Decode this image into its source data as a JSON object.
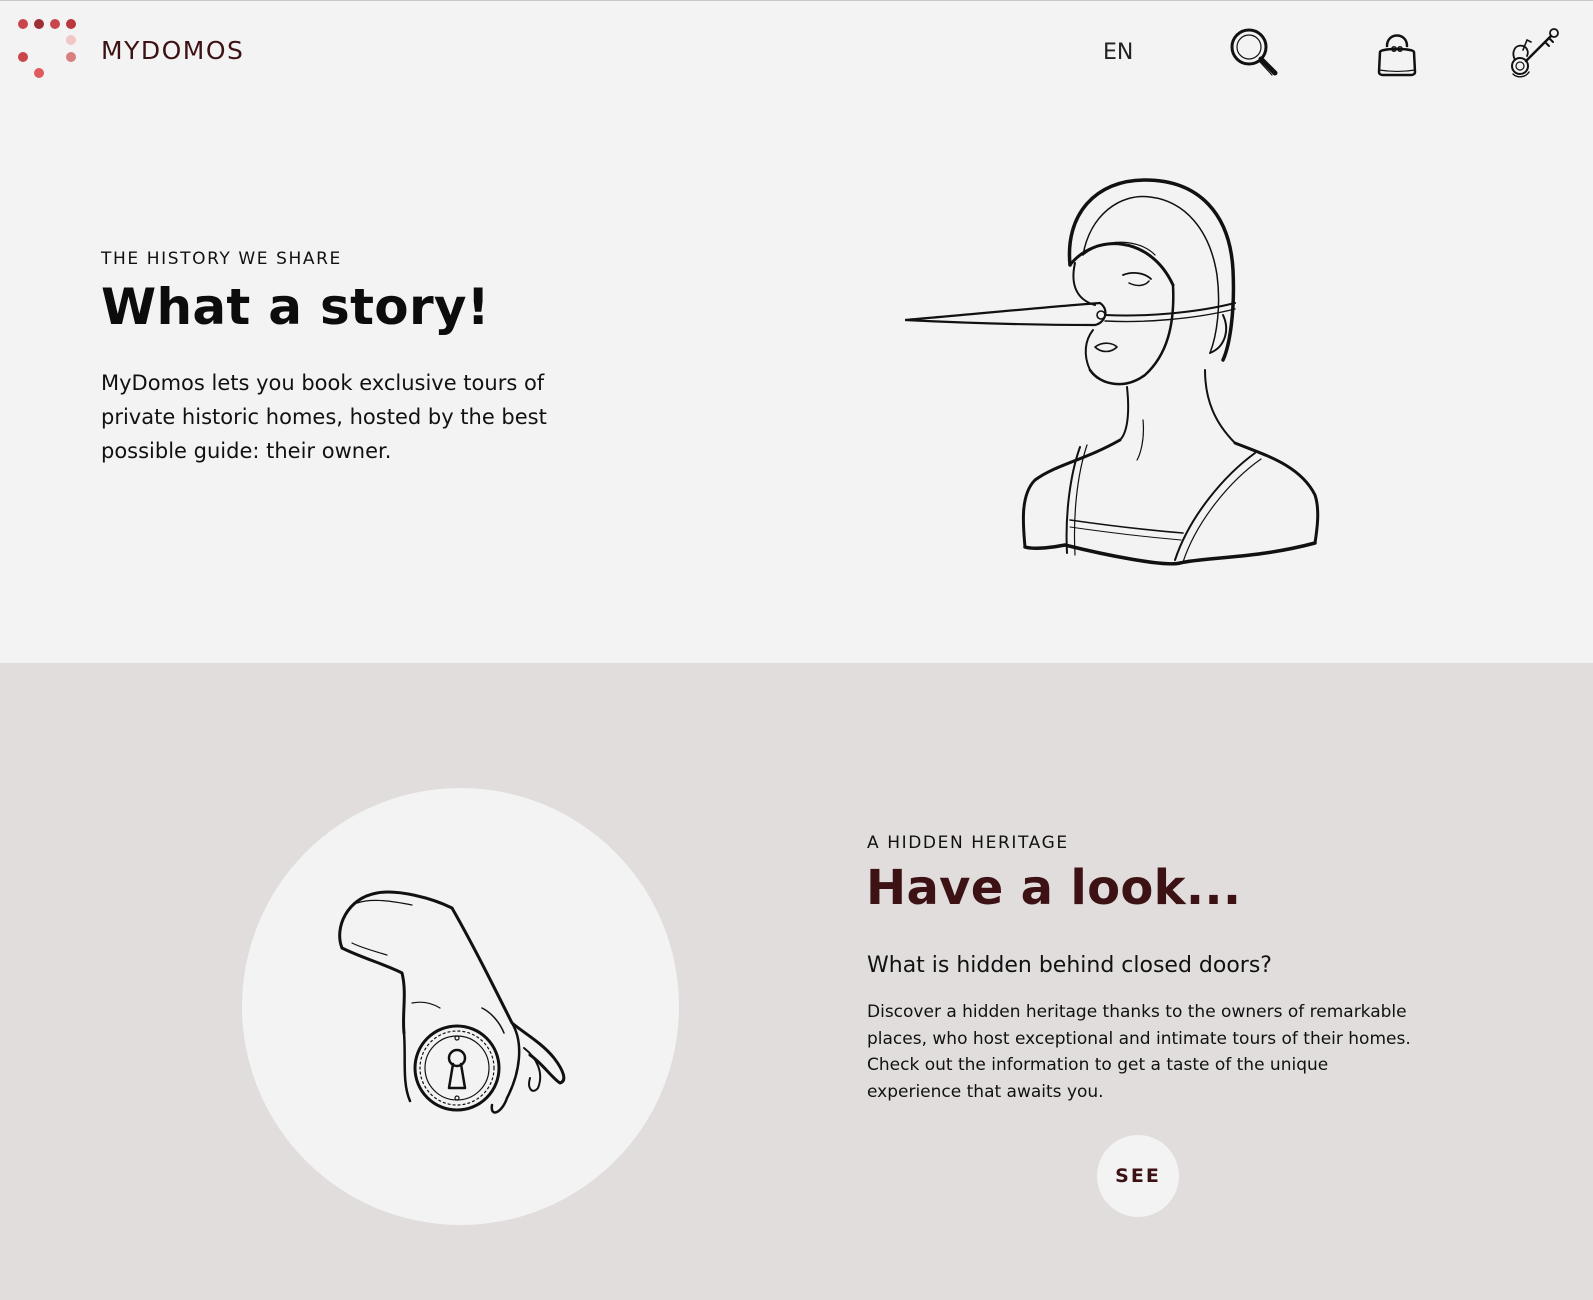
{
  "header": {
    "brand": "MYDOMOS",
    "language": "EN",
    "icons": [
      "search-icon",
      "bag-icon",
      "keys-icon"
    ],
    "logo_colors": [
      "#c9474b",
      "#9e2f34",
      "#c9474b",
      "#b8393e",
      "#f0c6c6",
      "#c9474b",
      "#d67e80",
      "#e05a5e"
    ]
  },
  "hero": {
    "eyebrow": "THE HISTORY WE SHARE",
    "title": "What a story!",
    "text": "MyDomos lets you book exclusive tours of private historic homes, hosted by the best possible guide: their owner."
  },
  "section2": {
    "eyebrow": "A HIDDEN HERITAGE",
    "title": "Have a look...",
    "subtitle": "What is hidden behind closed doors?",
    "text": "Discover a hidden heritage thanks to the owners of remarkable places, who host exceptional and intimate tours of their homes. Check out the information to get a taste of the unique experience that awaits you.",
    "button": "SEE"
  },
  "colors": {
    "brand": "#3d1214",
    "hero_bg": "#f3f3f3",
    "section_bg": "#e0dddc"
  }
}
